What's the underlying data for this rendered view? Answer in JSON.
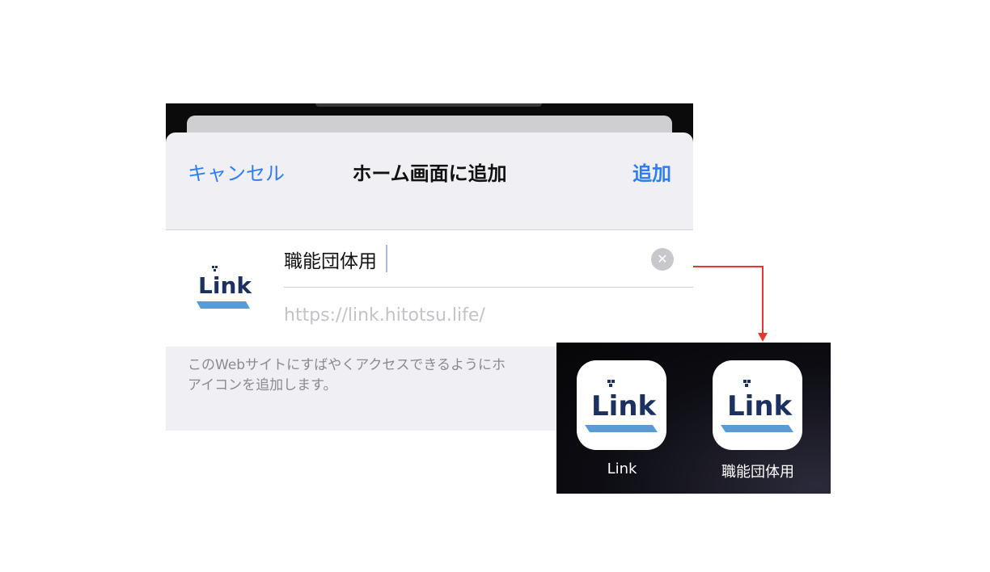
{
  "sheet": {
    "cancel_label": "キャンセル",
    "title": "ホーム画面に追加",
    "add_label": "追加",
    "logo_text": "Link",
    "name_value": "職能団体用",
    "url": "https://link.hitotsu.life/",
    "description_lines": [
      "このWebサイトにすばやくアクセスできるようにホ",
      "アイコンを追加します。"
    ]
  },
  "home": {
    "apps": [
      {
        "label": "Link",
        "logo_text": "Link"
      },
      {
        "label": "職能団体用",
        "logo_text": "Link"
      }
    ]
  },
  "colors": {
    "ios_blue": "#2f7df6",
    "logo_navy": "#1d3160",
    "logo_bar": "#5b9bd5",
    "arrow_red": "#e03a2e"
  },
  "icons": {
    "clear": "xmark-circle-icon",
    "arrow": "arrow-down-icon"
  }
}
